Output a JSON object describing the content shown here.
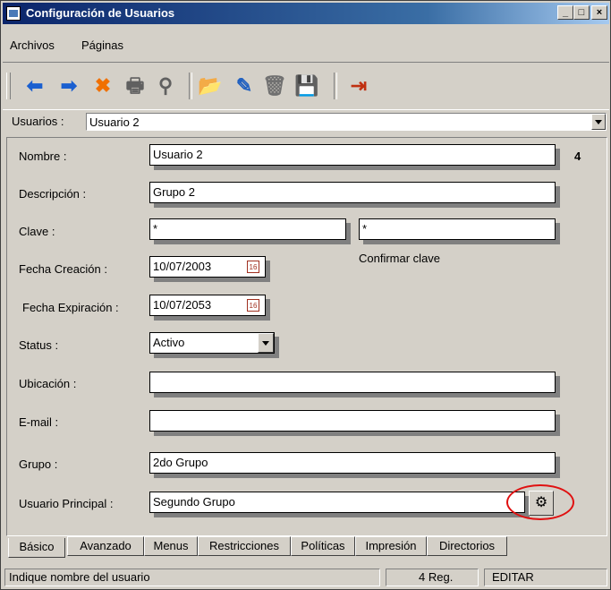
{
  "window": {
    "title": "Configuración de Usuarios"
  },
  "menu": {
    "items": [
      "Archivos",
      "Páginas"
    ]
  },
  "toolbar": {
    "buttons": [
      {
        "name": "back-icon",
        "glyph": "⬅",
        "color": "#1a5fd0"
      },
      {
        "name": "forward-icon",
        "glyph": "➡",
        "color": "#1a5fd0"
      },
      {
        "name": "delete-x-icon",
        "glyph": "✖",
        "color": "#f07000"
      },
      {
        "name": "print-icon",
        "glyph": "🖶",
        "color": "#606060"
      },
      {
        "name": "search-icon",
        "glyph": "⚲",
        "color": "#606060"
      },
      {
        "name": "new-folder-icon",
        "glyph": "📂",
        "color": "#c08020"
      },
      {
        "name": "edit-icon",
        "glyph": "✎",
        "color": "#2060c0"
      },
      {
        "name": "trash-icon",
        "glyph": "🗑",
        "color": "#707070"
      },
      {
        "name": "save-icon",
        "glyph": "💾",
        "color": "#8030a0"
      },
      {
        "name": "exit-door-icon",
        "glyph": "⇥",
        "color": "#c03010"
      }
    ]
  },
  "selector": {
    "label": "Usuarios :",
    "value": "Usuario 2"
  },
  "form": {
    "nombre_label": "Nombre :",
    "nombre_value": "Usuario 2",
    "count": "4",
    "descripcion_label": "Descripción :",
    "descripcion_value": "Grupo 2",
    "clave_label": "Clave :",
    "clave_value": "*",
    "confirmar_value": "*",
    "confirmar_label": "Confirmar clave",
    "fecha_creacion_label": "Fecha Creación :",
    "fecha_creacion_value": "10/07/2003",
    "fecha_expiracion_label": "Fecha Expiración :",
    "fecha_expiracion_value": "10/07/2053",
    "status_label": "Status :",
    "status_value": "Activo",
    "ubicacion_label": "Ubicación :",
    "ubicacion_value": "",
    "email_label": "E-mail :",
    "email_value": "",
    "grupo_label": "Grupo :",
    "grupo_value": "2do Grupo",
    "usuario_principal_label": "Usuario Principal :",
    "usuario_principal_value": "Segundo Grupo"
  },
  "tabs": [
    "Básico",
    "Avanzado",
    "Menus",
    "Restricciones",
    "Políticas",
    "Impresión",
    "Directorios"
  ],
  "status": {
    "message": "Indique nombre del usuario",
    "records": "4 Reg.",
    "mode": "EDITAR"
  }
}
